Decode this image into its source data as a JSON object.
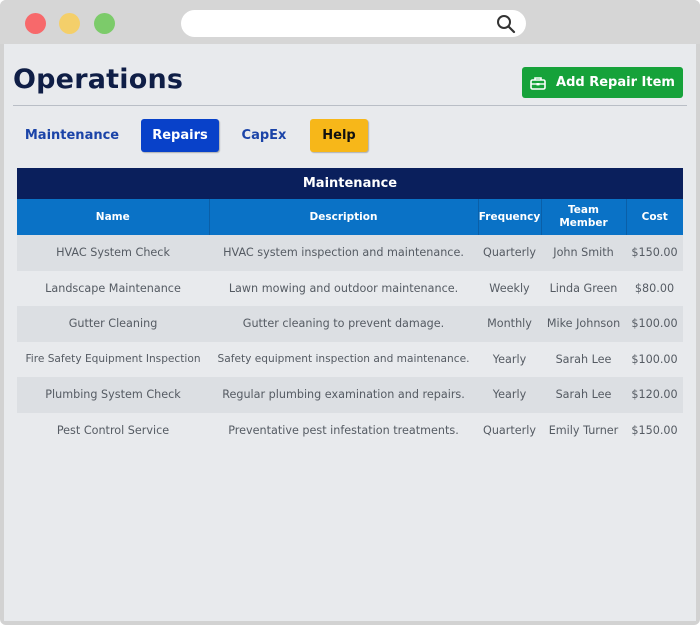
{
  "window": {
    "colors": {
      "close": "#f7696b",
      "minimize": "#f4cf6a",
      "maximize": "#7ccb6a"
    }
  },
  "header": {
    "title": "Operations",
    "add_button_label": "Add Repair Item",
    "add_button_icon": "toolbox-icon",
    "colors": {
      "title": "#0f1e46",
      "add_button": "#16a23a"
    }
  },
  "tabs": [
    {
      "label": "Maintenance",
      "active": false
    },
    {
      "label": "Repairs",
      "active": true
    },
    {
      "label": "CapEx",
      "active": false
    },
    {
      "label": "Help",
      "active": false
    }
  ],
  "table": {
    "title": "Maintenance",
    "columns": [
      "Name",
      "Description",
      "Frequency",
      "Team Member",
      "Cost"
    ],
    "rows": [
      [
        "HVAC System Check",
        "HVAC system inspection and maintenance.",
        "Quarterly",
        "John Smith",
        "$150.00"
      ],
      [
        "Landscape Maintenance",
        "Lawn mowing and outdoor maintenance.",
        "Weekly",
        "Linda Green",
        "$80.00"
      ],
      [
        "Gutter Cleaning",
        "Gutter cleaning to prevent damage.",
        "Monthly",
        "Mike Johnson",
        "$100.00"
      ],
      [
        "Fire Safety Equipment Inspection",
        "Safety equipment inspection and maintenance.",
        "Yearly",
        "Sarah Lee",
        "$100.00"
      ],
      [
        "Plumbing System Check",
        "Regular plumbing examination and repairs.",
        "Yearly",
        "Sarah Lee",
        "$120.00"
      ],
      [
        "Pest Control Service",
        "Preventative pest infestation treatments.",
        "Quarterly",
        "Emily Turner",
        "$150.00"
      ]
    ],
    "colors": {
      "title_bar": "#0a1f5c",
      "header_row": "#0a72c6"
    }
  }
}
